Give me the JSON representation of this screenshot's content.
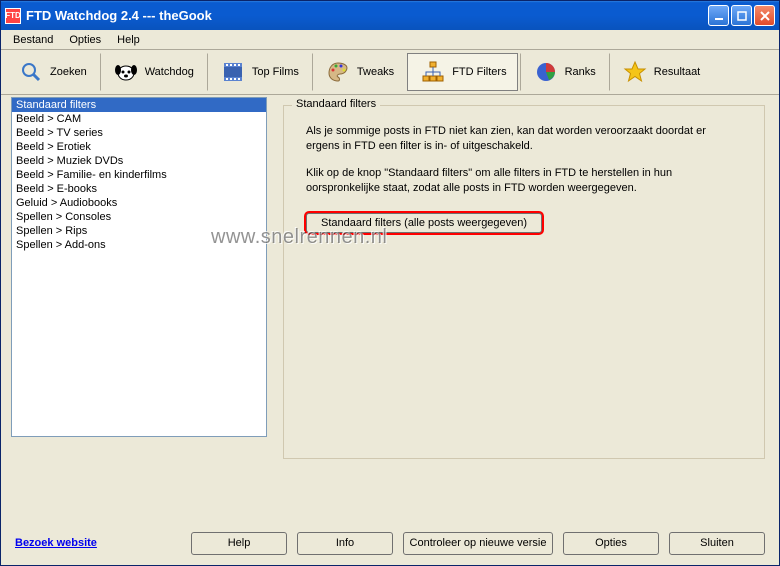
{
  "window": {
    "title": "FTD Watchdog 2.4  ---  theGook"
  },
  "menu": {
    "items": [
      "Bestand",
      "Opties",
      "Help"
    ]
  },
  "toolbar": {
    "zoeken": "Zoeken",
    "watchdog": "Watchdog",
    "topfilms": "Top Films",
    "tweaks": "Tweaks",
    "ftdfilters": "FTD Filters",
    "ranks": "Ranks",
    "resultaat": "Resultaat"
  },
  "list": {
    "items": [
      "Standaard filters",
      "Beeld > CAM",
      "Beeld > TV series",
      "Beeld > Erotiek",
      "Beeld > Muziek DVDs",
      "Beeld > Familie- en kinderfilms",
      "Beeld > E-books",
      "Geluid > Audiobooks",
      "Spellen > Consoles",
      "Spellen > Rips",
      "Spellen > Add-ons"
    ]
  },
  "group": {
    "title": "Standaard filters",
    "p1": "Als je sommige posts in FTD niet kan zien, kan dat worden veroorzaakt doordat er ergens in FTD een filter is in- of uitgeschakeld.",
    "p2": "Klik op de knop \"Standaard filters\" om alle filters in FTD te herstellen in hun oorspronkelijke staat, zodat alle posts in FTD worden weergegeven.",
    "button": "Standaard filters (alle posts weergegeven)"
  },
  "footer": {
    "link": "Bezoek website",
    "help": "Help",
    "info": "Info",
    "check": "Controleer op nieuwe versie",
    "opties": "Opties",
    "sluiten": "Sluiten"
  },
  "watermark": "www.snelrennen.nl"
}
